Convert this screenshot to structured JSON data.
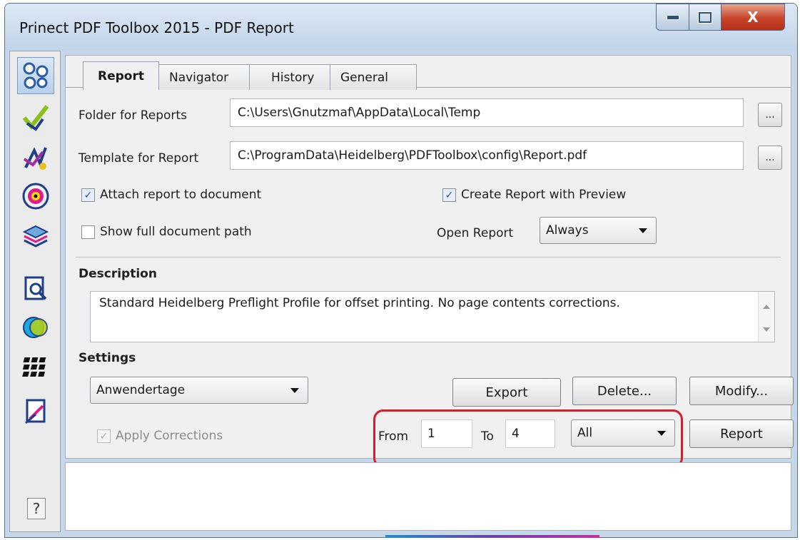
{
  "window": {
    "title": "Prinect PDF Toolbox 2015 - PDF Report",
    "close_glyph": "X"
  },
  "sidebar": {
    "icons": [
      "report-icon",
      "preflight-check-icon",
      "fixups-icon",
      "color-disc-icon",
      "layers-icon",
      "inspect-magnifier-icon",
      "color-circles-icon",
      "grid-icon",
      "edit-document-icon"
    ],
    "help_label": "?"
  },
  "tabs": [
    {
      "label": "Report",
      "active": true
    },
    {
      "label": "Navigator",
      "active": false
    },
    {
      "label": "History",
      "active": false
    },
    {
      "label": "General",
      "active": false
    }
  ],
  "form": {
    "folder_label": "Folder for Reports",
    "folder_value": "C:\\Users\\Gnutzmaf\\AppData\\Local\\Temp",
    "template_label": "Template for Report",
    "template_value": "C:\\ProgramData\\Heidelberg\\PDFToolbox\\config\\Report.pdf",
    "browse_label": "...",
    "attach_label": "Attach report to document",
    "attach_checked": true,
    "preview_label": "Create Report with Preview",
    "preview_checked": true,
    "fullpath_label": "Show full document path",
    "fullpath_checked": false,
    "open_report_label": "Open Report",
    "open_report_value": "Always",
    "check_glyph": "✓"
  },
  "description": {
    "heading": "Description",
    "text": "Standard Heidelberg Preflight Profile for offset printing. No page contents corrections."
  },
  "settings": {
    "heading": "Settings",
    "profile_value": "Anwendertage",
    "export_label": "Export",
    "delete_label": "Delete...",
    "modify_label": "Modify...",
    "apply_label": "Apply Corrections",
    "apply_checked": true,
    "apply_disabled": true,
    "from_label": "From",
    "from_value": "1",
    "to_label": "To",
    "to_value": "4",
    "range_value": "All",
    "report_label": "Report"
  },
  "colors": {
    "highlight": "#d21f2b",
    "titlebar": "#c6d7ea",
    "close": "#c8442a"
  }
}
